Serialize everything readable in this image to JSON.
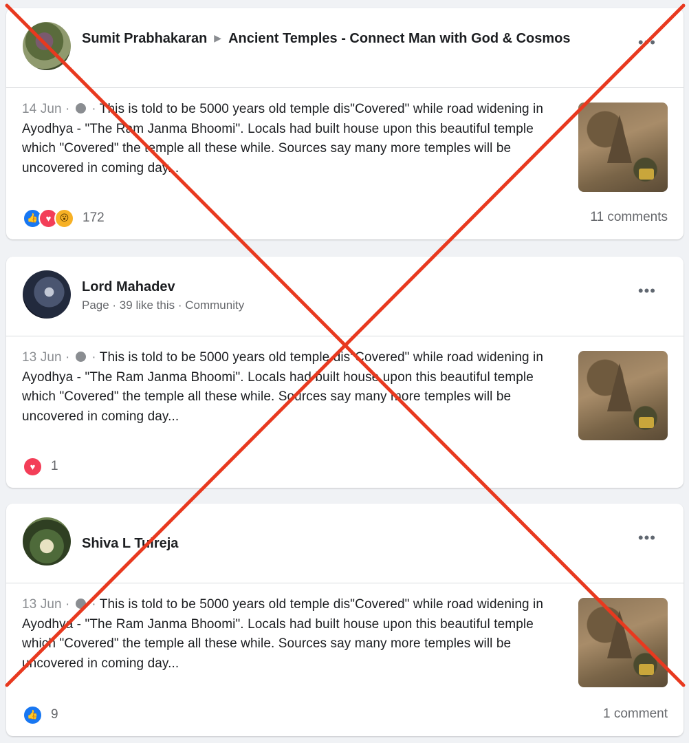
{
  "posts": [
    {
      "author": "Sumit Prabhakaran",
      "group": "Ancient Temples - Connect Man with God & Cosmos",
      "date": "14 Jun",
      "text": "This is told to be 5000 years old temple dis\"Covered\" while road widening in Ayodhya - \"The Ram Janma Bhoomi\". Locals had built house upon this beautiful temple which \"Covered\" the temple all these while. Sources say many more temples will be uncovered in coming day...",
      "reaction_count": "172",
      "reactions": [
        "like",
        "love",
        "wow"
      ],
      "comments": "11 comments"
    },
    {
      "author": "Lord Mahadev",
      "subline": "Page · 39 like this · Community",
      "date": "13 Jun",
      "text": "This is told to be 5000 years old temple dis\"Covered\" while road widening in Ayodhya - \"The Ram Janma Bhoomi\". Locals had built house upon this beautiful temple which \"Covered\" the temple all these while. Sources say many more temples will be uncovered in coming day...",
      "reaction_count": "1",
      "reactions": [
        "love"
      ],
      "comments": ""
    },
    {
      "author": "Shiva L Tulreja",
      "date": "13 Jun",
      "text": "This is told to be 5000 years old temple dis\"Covered\" while road widening in Ayodhya - \"The Ram Janma Bhoomi\". Locals had built house upon this beautiful temple which \"Covered\" the temple all these while. Sources say many more temples will be uncovered in coming day...",
      "reaction_count": "9",
      "reactions": [
        "like"
      ],
      "comments": "1 comment"
    }
  ],
  "ui": {
    "more_glyph": "•••",
    "meta_sep": "·",
    "group_arrow": "▶",
    "icons": {
      "like": "thumbs-up-icon",
      "love": "heart-icon",
      "wow": "wow-face-icon",
      "privacy": "globe-icon",
      "more": "more-options-icon"
    }
  },
  "overlay": {
    "mark": "red-x",
    "color": "#e8391f"
  }
}
